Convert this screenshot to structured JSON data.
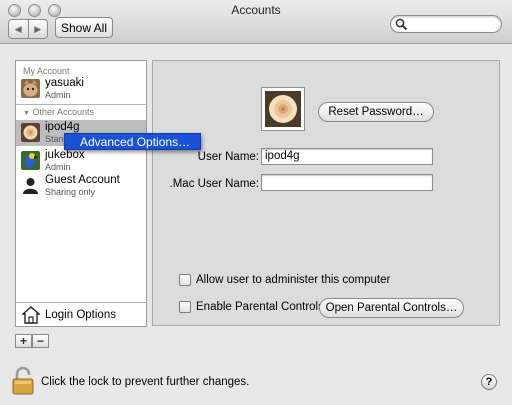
{
  "window": {
    "title": "Accounts"
  },
  "toolbar": {
    "back_icon": "◀",
    "forward_icon": "▶",
    "show_all_label": "Show All"
  },
  "sidebar": {
    "my_account_header": "My Account",
    "my_account": {
      "name": "yasuaki",
      "role": "Admin",
      "icon": "cat-avatar"
    },
    "other_accounts_header": "Other Accounts",
    "other_accounts_disclosure_icon": "▼",
    "others": [
      {
        "name": "ipod4g",
        "role": "Stand",
        "icon": "rose-avatar",
        "selected": true
      },
      {
        "name": "jukebox",
        "role": "Admin",
        "icon": "parrot-avatar"
      },
      {
        "name": "Guest Account",
        "role": "Sharing only",
        "icon": "person-silhouette"
      }
    ],
    "login_options_label": "Login Options",
    "add_label": "+",
    "remove_label": "−"
  },
  "context_menu": {
    "items": [
      "Advanced Options…"
    ]
  },
  "detail": {
    "reset_password_label": "Reset Password…",
    "user_name_label": "User Name:",
    "user_name_value": "ipod4g",
    "mac_user_name_label": ".Mac User Name:",
    "mac_user_name_value": "",
    "allow_admin_label": "Allow user to administer this computer",
    "allow_admin_checked": false,
    "parental_controls_label": "Enable Parental Controls",
    "parental_controls_checked": false,
    "open_parental_controls_label": "Open Parental Controls…"
  },
  "footer": {
    "lock_text": "Click the lock to prevent further changes.",
    "help_label": "?"
  }
}
